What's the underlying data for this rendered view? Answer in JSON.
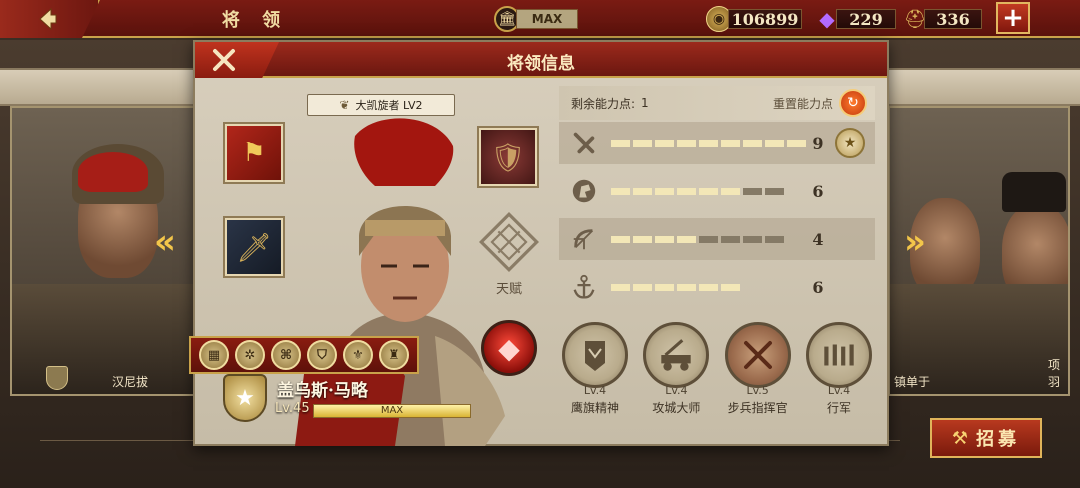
{
  "topbar": {
    "title": "将 领",
    "building_level": "MAX",
    "currency_coins": "106899",
    "currency_gems": "229",
    "currency_helmets": "336"
  },
  "background_generals": {
    "left_name": "汉尼拔",
    "right_name_1": "镇单于",
    "right_name_2": "项羽"
  },
  "recruit": {
    "label": "招募"
  },
  "panel": {
    "title": "将领信息",
    "title_tag": "大凯旋者 LV2",
    "talent_label": "天赋",
    "general_name": "盖乌斯·马略",
    "general_level": "Lv.45",
    "xp_text": "MAX",
    "xp_fill": 1.0,
    "skill_strip_icons": [
      "codex-icon",
      "compass-icon",
      "banner-icon",
      "shield-icon",
      "armor-icon",
      "helmet-icon"
    ]
  },
  "abilities": {
    "remaining_label": "剩余能力点:",
    "remaining_value": "1",
    "reset_label": "重置能力点",
    "stats": [
      {
        "icon": "sword-icon",
        "value": "9",
        "filled": 9,
        "total": 9,
        "maxed": true
      },
      {
        "icon": "cavalry-icon",
        "value": "6",
        "filled": 6,
        "total": 8,
        "maxed": false
      },
      {
        "icon": "bow-icon",
        "value": "4",
        "filled": 4,
        "total": 8,
        "maxed": false
      },
      {
        "icon": "anchor-icon",
        "value": "6",
        "filled": 6,
        "total": 6,
        "maxed": false
      }
    ]
  },
  "skills": [
    {
      "level": "Lv.4",
      "name": "鹰旗精神"
    },
    {
      "level": "Lv.4",
      "name": "攻城大师"
    },
    {
      "level": "Lv.5",
      "name": "步兵指挥官"
    },
    {
      "level": "Lv.4",
      "name": "行军"
    }
  ],
  "colors": {
    "accent_red": "#7a1b13",
    "gold": "#c9a24a",
    "parchment": "#d8cfbd"
  }
}
